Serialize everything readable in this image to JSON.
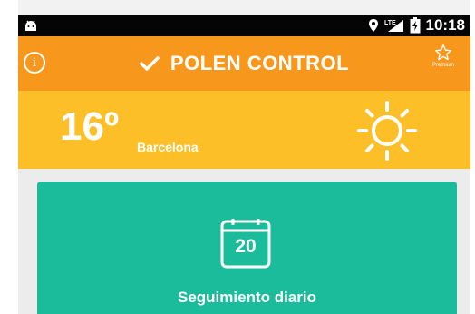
{
  "status_bar": {
    "time": "10:18",
    "icons": [
      "android-icon",
      "location-pin-icon",
      "lte-signal-icon",
      "battery-charging-icon"
    ]
  },
  "app_bar": {
    "title": "POLEN CONTROL",
    "premium_label": "Premium",
    "icons": [
      "info-icon",
      "check-icon",
      "star-icon"
    ]
  },
  "weather": {
    "temperature": "16º",
    "city": "Barcelona",
    "condition_icon": "sun-icon"
  },
  "daily_card": {
    "day": "20",
    "label": "Seguimiento diario",
    "icon": "calendar-icon"
  },
  "colors": {
    "status_bar": "#050505",
    "app_bar": "#f7981c",
    "weather_bar": "#fdbf27",
    "card": "#1bbc9b",
    "background": "#ececec"
  }
}
